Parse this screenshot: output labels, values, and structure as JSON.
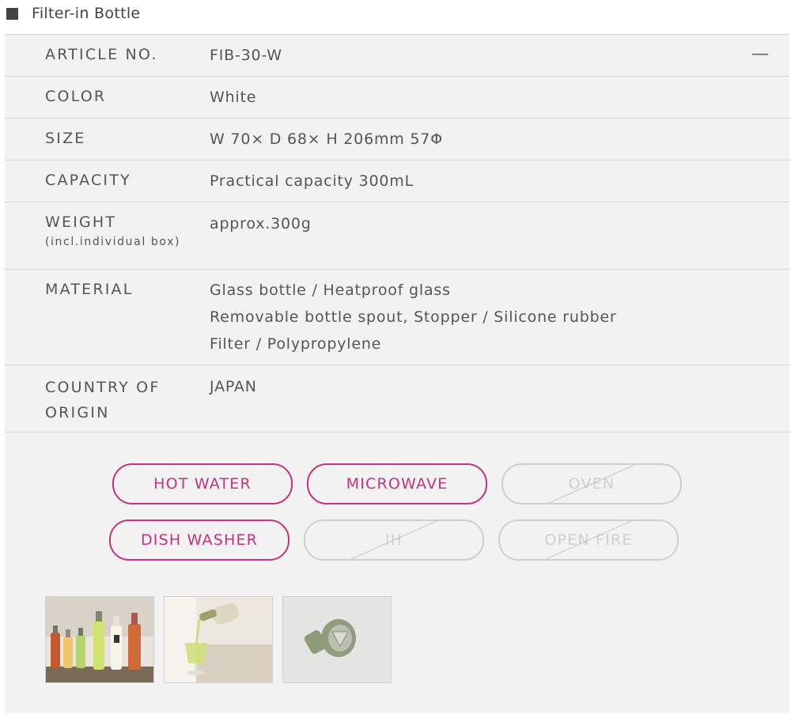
{
  "header": {
    "title": "Filter-in Bottle"
  },
  "specs": [
    {
      "label": "ARTICLE NO.",
      "value": "FIB-30-W"
    },
    {
      "label": "COLOR",
      "value": "White"
    },
    {
      "label": "SIZE",
      "value": "W 70× D 68× H 206mm 57Φ"
    },
    {
      "label": "CAPACITY",
      "value": "Practical capacity 300mL"
    },
    {
      "label": "WEIGHT",
      "label_sub": "(incl.individual box)",
      "value": "approx.300g"
    },
    {
      "label": "MATERIAL",
      "value_lines": [
        "Glass bottle / Heatproof glass",
        "Removable bottle spout, Stopper / Silicone rubber",
        "Filter / Polypropylene"
      ]
    },
    {
      "label_lines": [
        "COUNTRY OF",
        "ORIGIN"
      ],
      "value": "JAPAN"
    }
  ],
  "collapse_symbol": "—",
  "badges": [
    {
      "label": "HOT WATER",
      "enabled": true
    },
    {
      "label": "MICROWAVE",
      "enabled": true
    },
    {
      "label": "OVEN",
      "enabled": false
    },
    {
      "label": "DISH WASHER",
      "enabled": true
    },
    {
      "label": "IH",
      "enabled": false
    },
    {
      "label": "OPEN FIRE",
      "enabled": false
    }
  ],
  "colors": {
    "accent": "#c8317b",
    "disabled": "#cfcfcf",
    "panel_bg": "#f2f2f2",
    "divider": "#d4d4d4"
  }
}
